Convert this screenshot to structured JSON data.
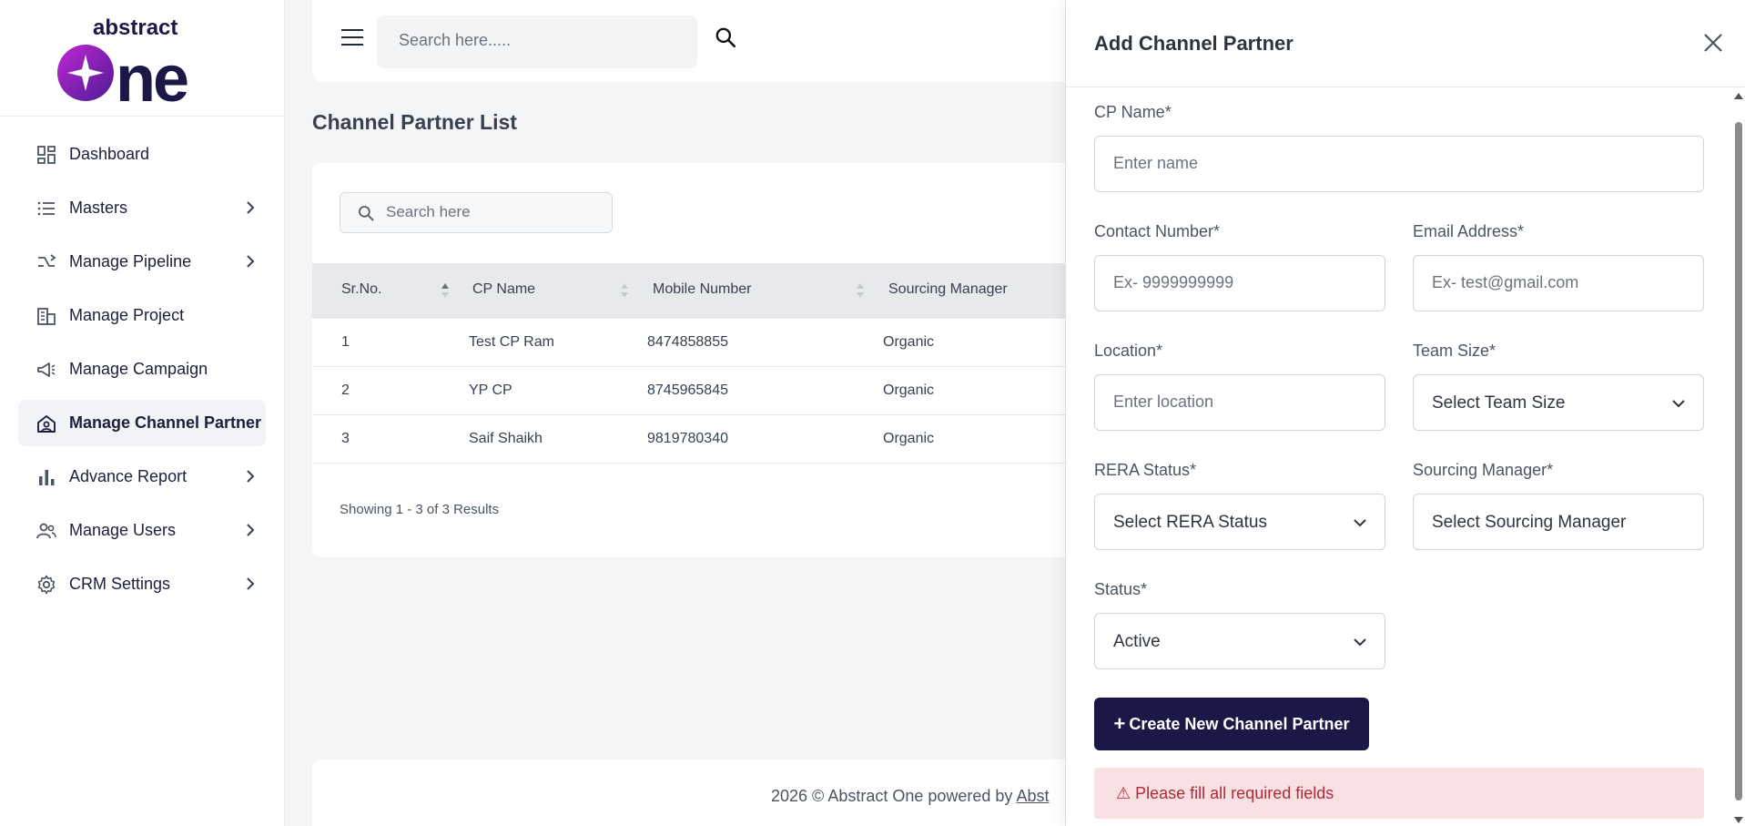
{
  "brand": {
    "logo_top": "abstract",
    "logo_main": "one",
    "colors": {
      "primary": "#1b1847",
      "accent_purple": "#6d28d9",
      "error_bg": "#f9e1e3",
      "error_text": "#b02a37"
    }
  },
  "sidebar": {
    "items": [
      {
        "label": "Dashboard",
        "icon": "dashboard-icon",
        "has_submenu": false
      },
      {
        "label": "Masters",
        "icon": "list-icon",
        "has_submenu": true
      },
      {
        "label": "Manage Pipeline",
        "icon": "pipeline-icon",
        "has_submenu": true
      },
      {
        "label": "Manage Project",
        "icon": "building-icon",
        "has_submenu": false
      },
      {
        "label": "Manage Campaign",
        "icon": "megaphone-icon",
        "has_submenu": false
      },
      {
        "label": "Manage Channel Partner",
        "icon": "partner-icon",
        "has_submenu": false,
        "active": true
      },
      {
        "label": "Advance Report",
        "icon": "chart-icon",
        "has_submenu": true
      },
      {
        "label": "Manage Users",
        "icon": "users-icon",
        "has_submenu": true
      },
      {
        "label": "CRM Settings",
        "icon": "gear-icon",
        "has_submenu": true
      }
    ]
  },
  "topbar": {
    "search_placeholder": "Search here....."
  },
  "main": {
    "title": "Channel Partner List",
    "list_search_placeholder": "Search here",
    "table": {
      "columns": [
        "Sr.No.",
        "CP Name",
        "Mobile Number",
        "Sourcing Manager"
      ],
      "rows": [
        [
          "1",
          "Test CP Ram",
          "8474858855",
          "Organic"
        ],
        [
          "2",
          "YP CP",
          "8745965845",
          "Organic"
        ],
        [
          "3",
          "Saif Shaikh",
          "9819780340",
          "Organic"
        ]
      ]
    },
    "showing": "Showing 1 - 3 of 3 Results"
  },
  "footer": {
    "text": "2026 © Abstract One powered by ",
    "link": "Abst"
  },
  "drawer": {
    "title": "Add Channel Partner",
    "fields": {
      "cp_name": {
        "label": "CP Name*",
        "placeholder": "Enter name"
      },
      "contact": {
        "label": "Contact Number*",
        "placeholder": "Ex- 9999999999"
      },
      "email": {
        "label": "Email Address*",
        "placeholder": "Ex- test@gmail.com"
      },
      "location": {
        "label": "Location*",
        "placeholder": "Enter location"
      },
      "team_size": {
        "label": "Team Size*",
        "value": "Select Team Size"
      },
      "rera": {
        "label": "RERA Status*",
        "value": "Select RERA Status"
      },
      "sourcing": {
        "label": "Sourcing Manager*",
        "value": "Select Sourcing Manager"
      },
      "status": {
        "label": "Status*",
        "value": "Active"
      }
    },
    "create_button": "Create New Channel Partner",
    "create_button_icon": "+",
    "error": "⚠ Please fill all required fields"
  }
}
